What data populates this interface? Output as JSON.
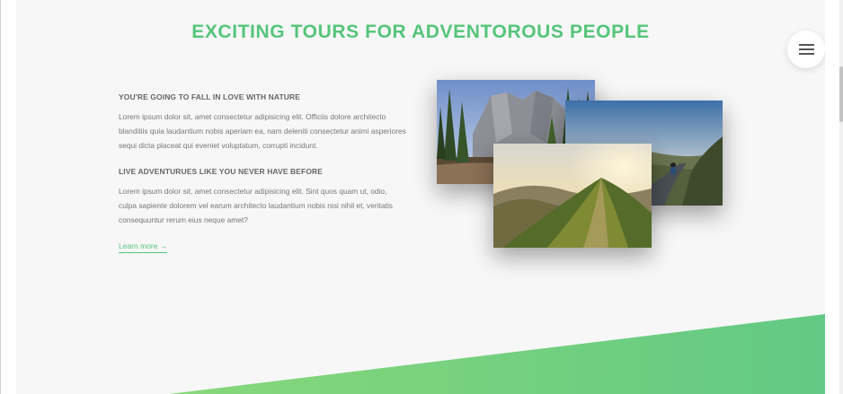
{
  "section": {
    "title": "EXCITING TOURS FOR ADVENTOROUS PEOPLE"
  },
  "nav": {
    "menu_icon": "hamburger-icon"
  },
  "content": {
    "heading_1": "YOU'RE GOING TO FALL IN LOVE WITH NATURE",
    "paragraph_1": "Lorem ipsum dolor sit, amet consectetur adipisicing elit. Officiis dolore architecto blanditiis quia laudantium nobis aperiam ea, nam deleniti consectetur animi asperiores sequi dicta placeat qui eveniet voluptatum, corrupti incidunt.",
    "heading_2": "LIVE ADVENTURUES LIKE YOU NEVER HAVE BEFORE",
    "paragraph_2": "Lorem ipsum dolor sit, amet consectetur adipisicing elit. Sint quos quam ut, odio, culpa sapiente dolorem vel earum architecto laudantium nobis nisi nihil et, veritatis consequuntur rerum eius neque amet?",
    "link_label": "Learn more →"
  },
  "images": [
    {
      "name": "forest-cliffs-photo"
    },
    {
      "name": "cyclist-hill-road-photo"
    },
    {
      "name": "mountain-ridge-sunset-photo"
    }
  ],
  "colors": {
    "accent": "#55c57a",
    "accent_dark": "#28b485",
    "background": "#f7f7f7",
    "text": "#777777"
  }
}
